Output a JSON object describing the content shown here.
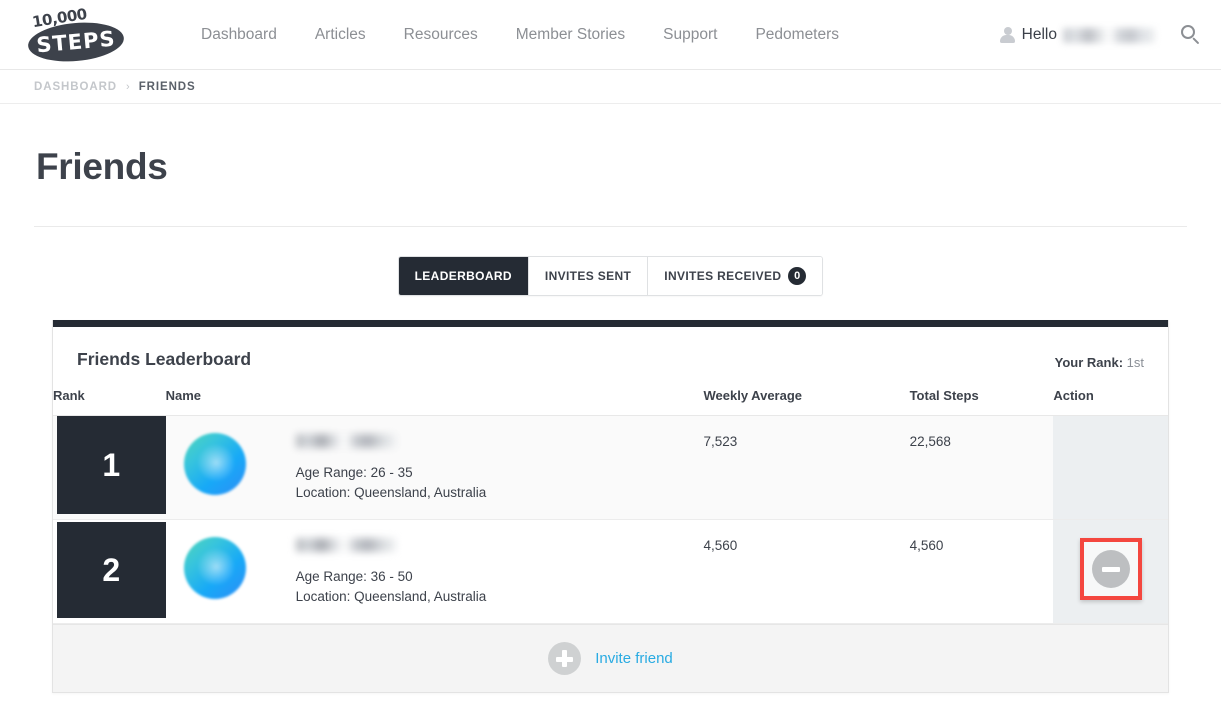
{
  "header": {
    "logo": {
      "top_text": "10,000",
      "main_text": "STEPS",
      "name": "logo"
    },
    "nav": [
      {
        "label": "Dashboard",
        "name": "nav-item-dashboard"
      },
      {
        "label": "Articles",
        "name": "nav-item-articles"
      },
      {
        "label": "Resources",
        "name": "nav-item-resources"
      },
      {
        "label": "Member Stories",
        "name": "nav-item-member-stories"
      },
      {
        "label": "Support",
        "name": "nav-item-support"
      },
      {
        "label": "Pedometers",
        "name": "nav-item-pedometers"
      }
    ],
    "greeting": "Hello",
    "user_name_redacted": true,
    "icons": {
      "user": "user-icon",
      "search": "search-icon"
    }
  },
  "breadcrumb": {
    "parent": "DASHBOARD",
    "separator": "›",
    "current": "FRIENDS"
  },
  "page": {
    "title": "Friends"
  },
  "tabs": [
    {
      "label": "LEADERBOARD",
      "active": true,
      "badge": null
    },
    {
      "label": "INVITES SENT",
      "active": false,
      "badge": null
    },
    {
      "label": "INVITES RECEIVED",
      "active": false,
      "badge": "0"
    }
  ],
  "leaderboard": {
    "title": "Friends Leaderboard",
    "your_rank_label": "Your Rank:",
    "your_rank_value": "1st",
    "columns": {
      "rank": "Rank",
      "name": "Name",
      "weekly_average": "Weekly Average",
      "total_steps": "Total Steps",
      "action": "Action"
    },
    "rows": [
      {
        "rank": "1",
        "name_redacted": true,
        "age_range": "Age Range: 26 - 35",
        "location": "Location: Queensland, Australia",
        "weekly_average": "7,523",
        "total_steps": "22,568",
        "has_remove_action": false
      },
      {
        "rank": "2",
        "name_redacted": true,
        "age_range": "Age Range: 36 - 50",
        "location": "Location: Queensland, Australia",
        "weekly_average": "4,560",
        "total_steps": "4,560",
        "has_remove_action": true
      }
    ],
    "footer": {
      "invite_label": "Invite friend",
      "invite_icon": "plus-circle-icon"
    }
  },
  "annotation": {
    "highlight_color": "#f4473f",
    "target": "remove-friend-button"
  },
  "colors": {
    "dark": "#252b34",
    "accent_link": "#29abe2",
    "text": "#3d424b",
    "muted": "#8a8f96",
    "action_cell_bg": "#eceff1",
    "footer_bg": "#f4f4f4"
  }
}
